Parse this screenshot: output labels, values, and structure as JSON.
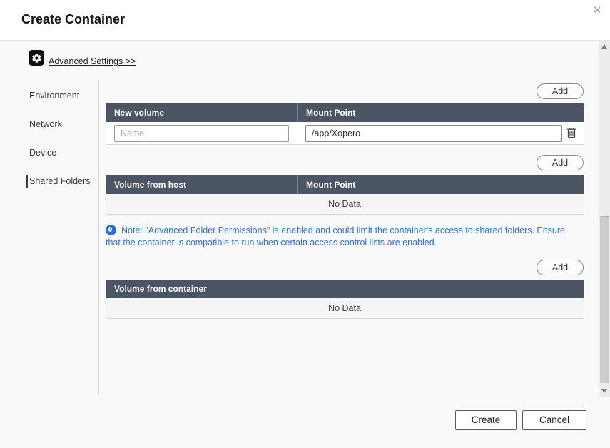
{
  "dialog": {
    "title": "Create Container",
    "close_icon": "×"
  },
  "advanced_settings": {
    "label": "Advanced Settings >>"
  },
  "sidebar": {
    "items": [
      {
        "label": "Environment",
        "active": false
      },
      {
        "label": "Network",
        "active": false
      },
      {
        "label": "Device",
        "active": false
      },
      {
        "label": "Shared Folders",
        "active": true
      }
    ]
  },
  "buttons": {
    "add": "Add",
    "create": "Create",
    "cancel": "Cancel"
  },
  "tables": {
    "new_volume": {
      "headers": [
        "New volume",
        "Mount Point"
      ],
      "row": {
        "name_placeholder": "Name",
        "mount_point_value": "/app/Xopero"
      }
    },
    "volume_from_host": {
      "headers": [
        "Volume from host",
        "Mount Point"
      ],
      "empty_text": "No Data"
    },
    "volume_from_container": {
      "headers": [
        "Volume from container"
      ],
      "empty_text": "No Data"
    }
  },
  "note": {
    "text": "Note: \"Advanced Folder Permissions\" is enabled and could limit the container's access to shared folders. Ensure that the container is compatible to run when certain access control lists are enabled."
  },
  "colors": {
    "table_header_bg": "#4c5563",
    "note_text": "#3570d4",
    "accent_dark": "#3d3d3d"
  }
}
